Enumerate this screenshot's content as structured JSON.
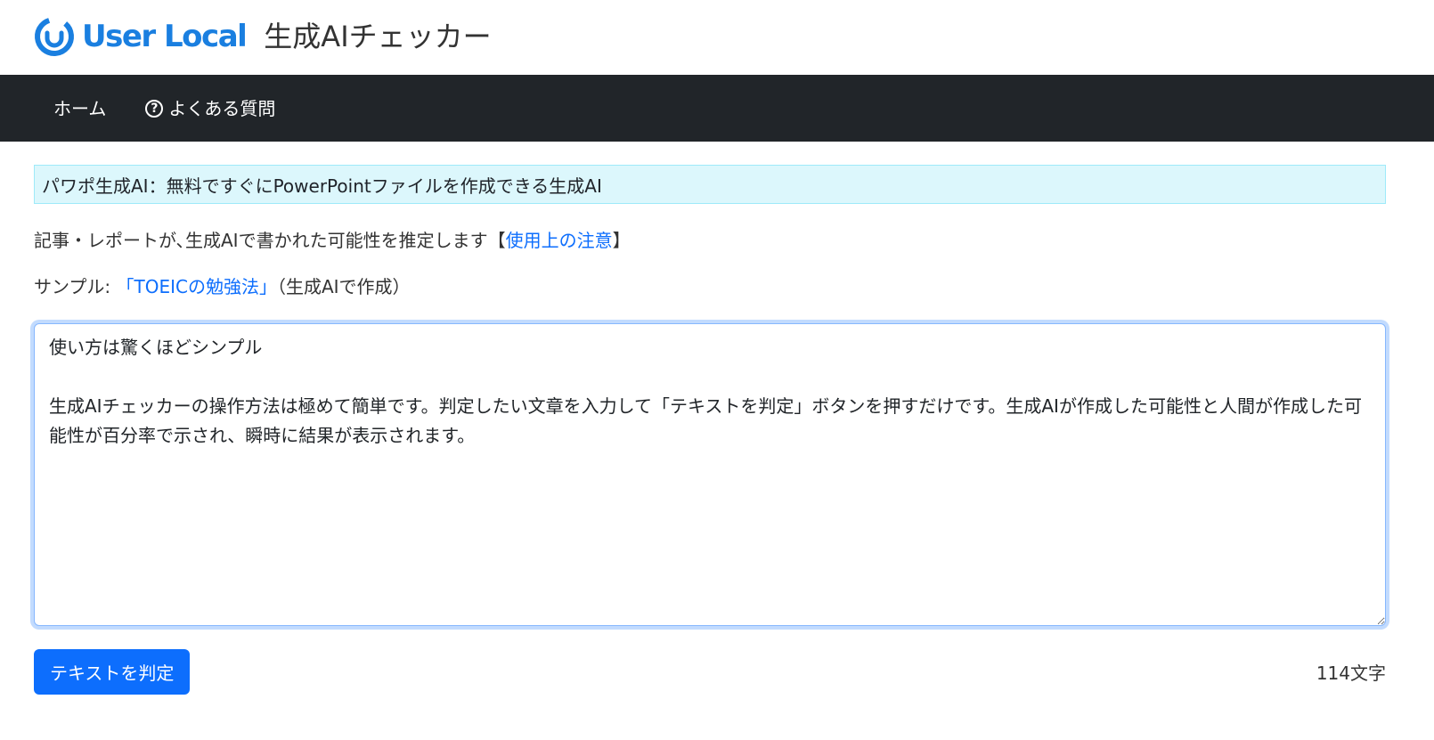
{
  "header": {
    "brand_name": "User Local",
    "product_name": "生成AIチェッカー",
    "brand_color": "#1a7fe0"
  },
  "nav": {
    "home_label": "ホーム",
    "faq_label": "よくある質問",
    "faq_icon": "question-circle-icon",
    "background": "#212529"
  },
  "banner": {
    "text": "パワポ生成AI：無料ですぐにPowerPointファイルを作成できる生成AI",
    "background": "#dcf7fc"
  },
  "description": {
    "text_before": "記事・レポートが､生成AIで書かれた可能性を推定します【",
    "link_text": "使用上の注意",
    "text_after": "】"
  },
  "sample": {
    "prefix": "サンプル: ",
    "link_text": "「TOEICの勉強法」",
    "suffix": "（生成AIで作成）"
  },
  "textbox": {
    "value": "使い方は驚くほどシンプル\n\n生成AIチェッカーの操作方法は極めて簡単です。判定したい文章を入力して「テキストを判定」ボタンを押すだけです。生成AIが作成した可能性と人間が作成した可能性が百分率で示され、瞬時に結果が表示されます。"
  },
  "actions": {
    "submit_label": "テキストを判定",
    "char_count": "114文字",
    "primary_color": "#0d6efd"
  }
}
